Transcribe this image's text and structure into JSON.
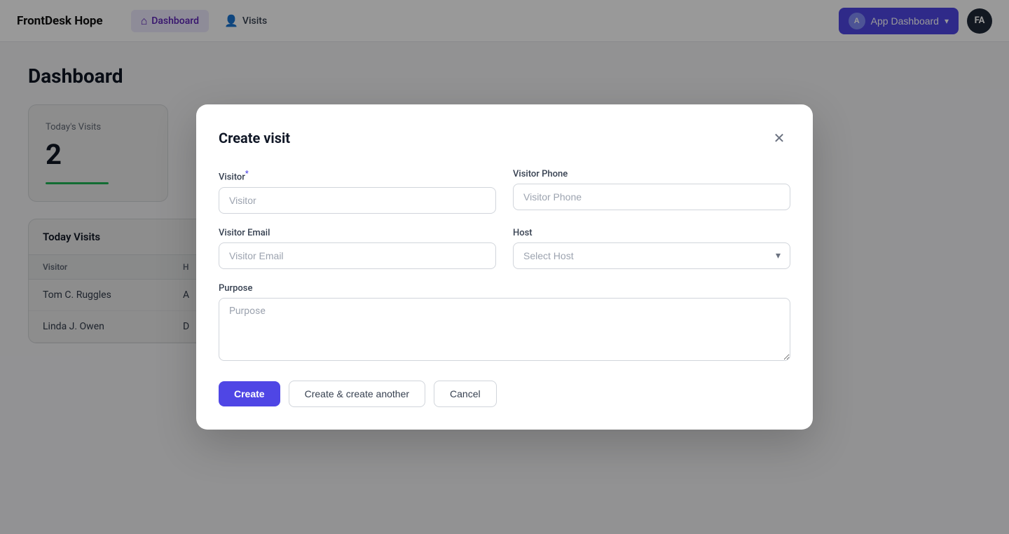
{
  "brand": "FrontDesk Hope",
  "nav": {
    "dashboard_label": "Dashboard",
    "visits_label": "Visits"
  },
  "header": {
    "app_dashboard_label": "App Dashboard",
    "app_avatar_letter": "A",
    "user_initials": "FA"
  },
  "main": {
    "page_title": "Dashboard",
    "stat_card": {
      "title": "Today's Visits",
      "value": "2"
    },
    "table": {
      "title": "Today Visits",
      "columns": [
        "Visitor",
        "H"
      ],
      "rows": [
        {
          "visitor": "Tom C. Ruggles",
          "host": "A"
        },
        {
          "visitor": "Linda J. Owen",
          "host": "D"
        }
      ]
    }
  },
  "modal": {
    "title": "Create visit",
    "visitor_label": "Visitor",
    "visitor_placeholder": "Visitor",
    "visitor_phone_label": "Visitor Phone",
    "visitor_phone_placeholder": "Visitor Phone",
    "visitor_email_label": "Visitor Email",
    "visitor_email_placeholder": "Visitor Email",
    "host_label": "Host",
    "host_placeholder": "Select Host",
    "purpose_label": "Purpose",
    "purpose_placeholder": "Purpose",
    "btn_create": "Create",
    "btn_create_another": "Create & create another",
    "btn_cancel": "Cancel"
  }
}
